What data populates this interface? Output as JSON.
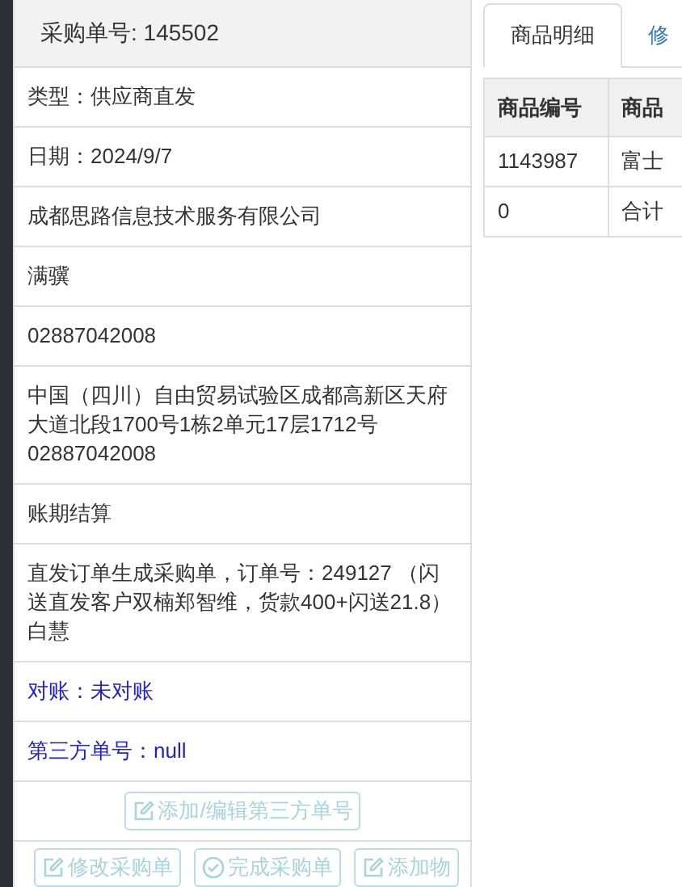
{
  "order_panel": {
    "title": "采购单号: 145502",
    "rows": [
      {
        "text": "类型：供应商直发",
        "kind": "plain"
      },
      {
        "text": "日期：2024/9/7",
        "kind": "plain"
      },
      {
        "text": "成都思路信息技术服务有限公司",
        "kind": "plain"
      },
      {
        "text": "满骥",
        "kind": "plain"
      },
      {
        "text": "02887042008",
        "kind": "plain"
      },
      {
        "text": "中国（四川）自由贸易试验区成都高新区天府大道北段1700号1栋2单元17层1712号 02887042008",
        "kind": "plain"
      },
      {
        "text": "账期结算",
        "kind": "plain"
      },
      {
        "text": "直发订单生成采购单，订单号：249127 （闪送直发客户双楠郑智维，货款400+闪送21.8）白慧",
        "kind": "plain"
      },
      {
        "text": "对账：未对账",
        "kind": "link"
      },
      {
        "text": "第三方单号：null",
        "kind": "link"
      }
    ],
    "third_party_button": {
      "label": "添加/编辑第三方单号",
      "kind": "edit",
      "disabled": true
    },
    "action_buttons": [
      {
        "label": "修改采购单",
        "kind": "edit",
        "disabled": true
      },
      {
        "label": "完成采购单",
        "kind": "check",
        "disabled": true
      },
      {
        "label": "添加物",
        "kind": "edit",
        "disabled": true
      }
    ]
  },
  "tabs": [
    {
      "label": "商品明细",
      "selected": true
    },
    {
      "label": "修",
      "selected": false
    }
  ],
  "table": {
    "columns": [
      "商品编号",
      "商品"
    ],
    "rows": [
      [
        "1143987",
        "富士"
      ],
      [
        "0",
        "合计"
      ]
    ]
  }
}
